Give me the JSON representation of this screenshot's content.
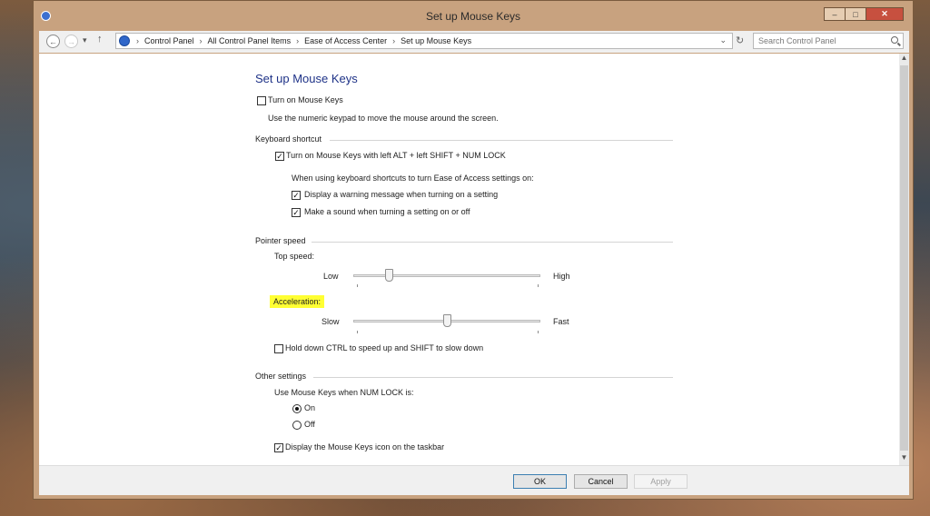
{
  "window": {
    "title": "Set up Mouse Keys",
    "controls": {
      "minimize": "–",
      "maximize": "□",
      "close": "✕"
    }
  },
  "nav": {
    "breadcrumbs": [
      "Control Panel",
      "All Control Panel Items",
      "Ease of Access Center",
      "Set up Mouse Keys"
    ],
    "search_placeholder": "Search Control Panel"
  },
  "page": {
    "heading": "Set up Mouse Keys",
    "turn_on_label": "Turn on Mouse Keys",
    "turn_on_checked": false,
    "turn_on_desc": "Use the numeric keypad to move the mouse around the screen.",
    "keyboard_shortcut": {
      "title": "Keyboard shortcut",
      "shortcut_label": "Turn on Mouse Keys with left ALT + left SHIFT + NUM LOCK",
      "shortcut_checked": true,
      "when_using": "When using keyboard shortcuts to turn Ease of Access settings on:",
      "warning_label": "Display a warning message when turning on a setting",
      "warning_checked": true,
      "sound_label": "Make a sound when turning a setting on or off",
      "sound_checked": true
    },
    "pointer_speed": {
      "title": "Pointer speed",
      "top_speed_label": "Top speed:",
      "top_low": "Low",
      "top_high": "High",
      "top_speed_fraction": 0.18,
      "acceleration_label": "Acceleration:",
      "acc_slow": "Slow",
      "acc_fast": "Fast",
      "acceleration_fraction": 0.5,
      "ctrl_label": "Hold down CTRL to speed up and SHIFT to slow down",
      "ctrl_checked": false
    },
    "other": {
      "title": "Other settings",
      "numlock_label": "Use Mouse Keys when NUM LOCK is:",
      "on_label": "On",
      "off_label": "Off",
      "selected": "On",
      "icon_label": "Display the Mouse Keys icon on the taskbar",
      "icon_checked": true
    }
  },
  "footer": {
    "ok": "OK",
    "cancel": "Cancel",
    "apply": "Apply"
  },
  "colors": {
    "heading": "#1e3287",
    "highlight": "#ffff33",
    "desktop": "#3c4753"
  }
}
